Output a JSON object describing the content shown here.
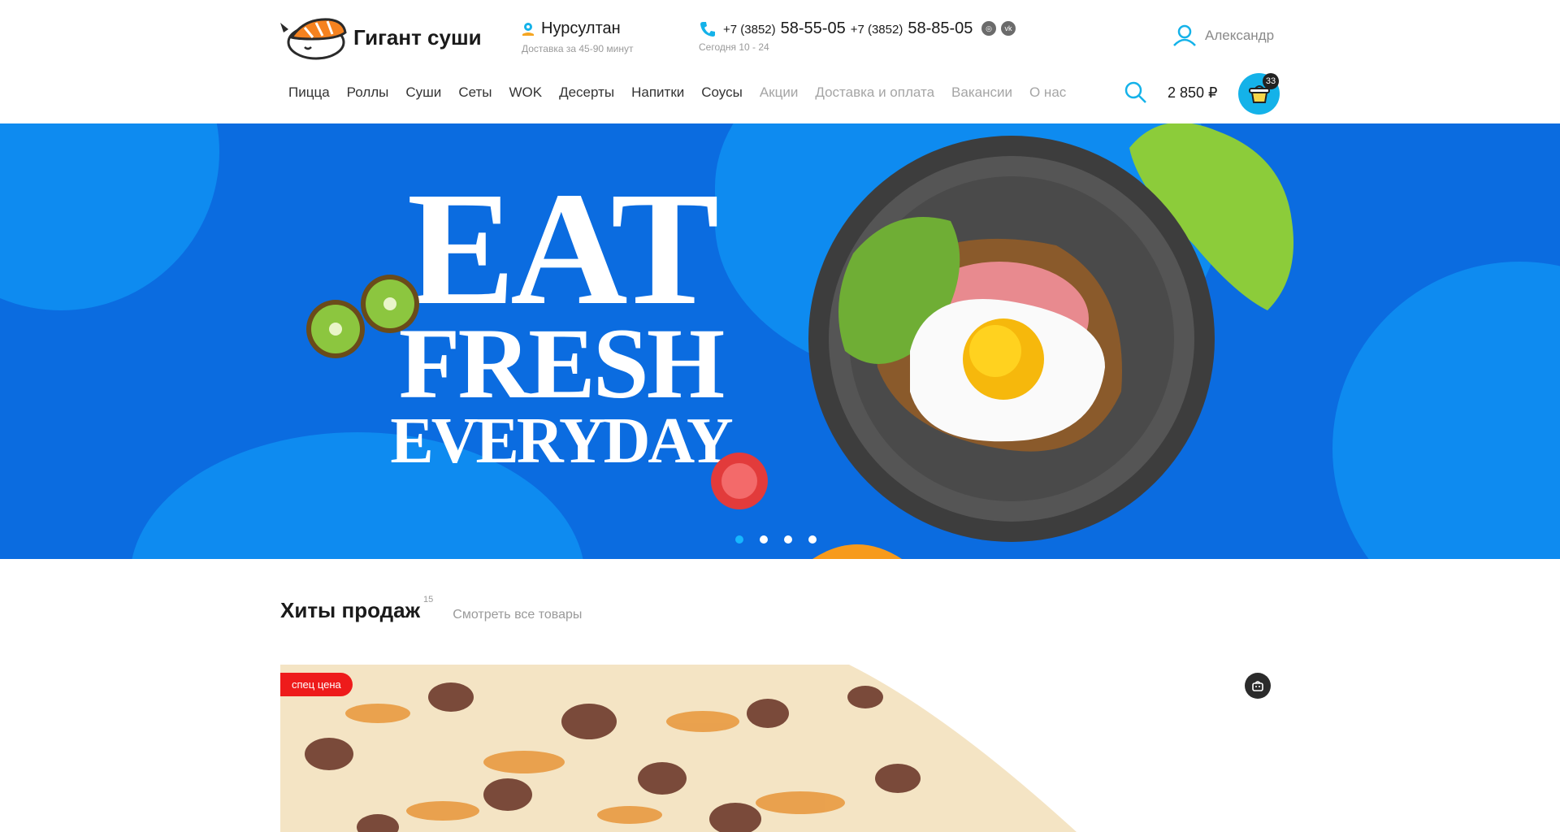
{
  "header": {
    "brand": "Гигант суши",
    "city": "Нурсултан",
    "delivery_note": "Доставка за 45-90 минут",
    "phones": [
      {
        "code": "+7 (3852)",
        "number": "58-55-05"
      },
      {
        "code": "+7 (3852)",
        "number": "58-85-05"
      }
    ],
    "hours": "Сегодня 10 - 24",
    "social": [
      "instagram-icon",
      "vk-icon"
    ],
    "user_name": "Александр",
    "cart_total": "2 850 ₽",
    "cart_count": "33"
  },
  "nav": {
    "items": [
      {
        "label": "Пицца"
      },
      {
        "label": "Роллы"
      },
      {
        "label": "Суши"
      },
      {
        "label": "Сеты"
      },
      {
        "label": "WOK"
      },
      {
        "label": "Десерты"
      },
      {
        "label": "Напитки"
      },
      {
        "label": "Соусы"
      },
      {
        "label": "Акции"
      },
      {
        "label": "Доставка и оплата"
      },
      {
        "label": "Вакансии"
      },
      {
        "label": "О нас"
      }
    ]
  },
  "banner": {
    "line1": "EAT",
    "line2": "FRESH",
    "line3": "EVERYDAY",
    "slides": 4,
    "active_slide": 1
  },
  "hits": {
    "title": "Хиты продаж",
    "count": "15",
    "view_all": "Смотреть все товары",
    "first_card_tag": "спец цена"
  },
  "colors": {
    "accent": "#14b2e9",
    "banner_bg": "#0b6ce0",
    "tag_red": "#ee1b1b"
  }
}
